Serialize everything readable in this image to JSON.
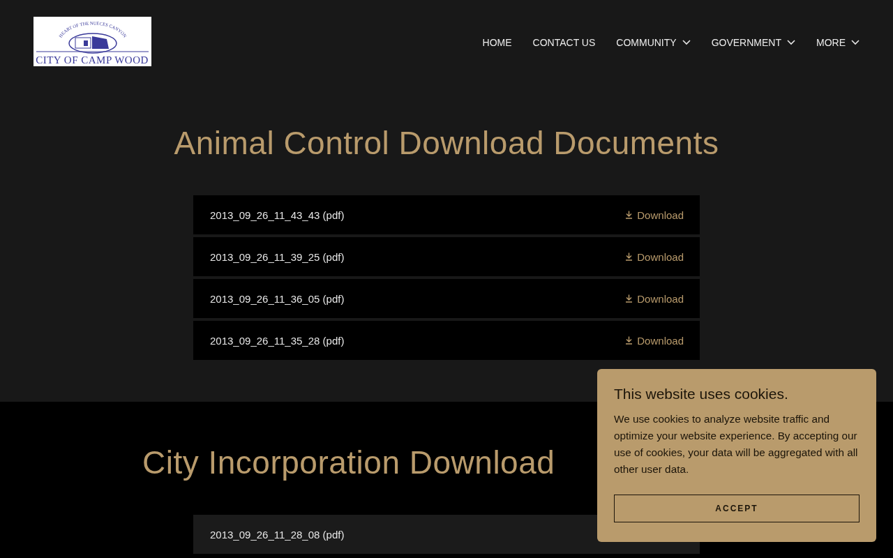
{
  "logo": {
    "motto": "HEART OF THE NUECES CANYON",
    "name": "CITY OF CAMP WOOD"
  },
  "nav": [
    {
      "label": "HOME",
      "dropdown": false
    },
    {
      "label": "CONTACT US",
      "dropdown": false
    },
    {
      "label": "COMMUNITY",
      "dropdown": true
    },
    {
      "label": "GOVERNMENT",
      "dropdown": true
    },
    {
      "label": "MORE",
      "dropdown": true
    }
  ],
  "sections": [
    {
      "title": "Animal Control Download Documents",
      "rows": [
        {
          "name": "2013_09_26_11_43_43",
          "type": "(pdf)",
          "action": "Download"
        },
        {
          "name": "2013_09_26_11_39_25",
          "type": "(pdf)",
          "action": "Download"
        },
        {
          "name": "2013_09_26_11_36_05",
          "type": "(pdf)",
          "action": "Download"
        },
        {
          "name": "2013_09_26_11_35_28",
          "type": "(pdf)",
          "action": "Download"
        }
      ]
    },
    {
      "title": "City Incorporation Download",
      "rows": [
        {
          "name": "2013_09_26_11_28_08",
          "type": "(pdf)"
        }
      ]
    }
  ],
  "cookie_banner": {
    "title": "This website uses cookies.",
    "text": "We use cookies to analyze website traffic and optimize your website experience. By accepting our use of cookies, your data will be aggregated with all other user data.",
    "button": "ACCEPT"
  }
}
